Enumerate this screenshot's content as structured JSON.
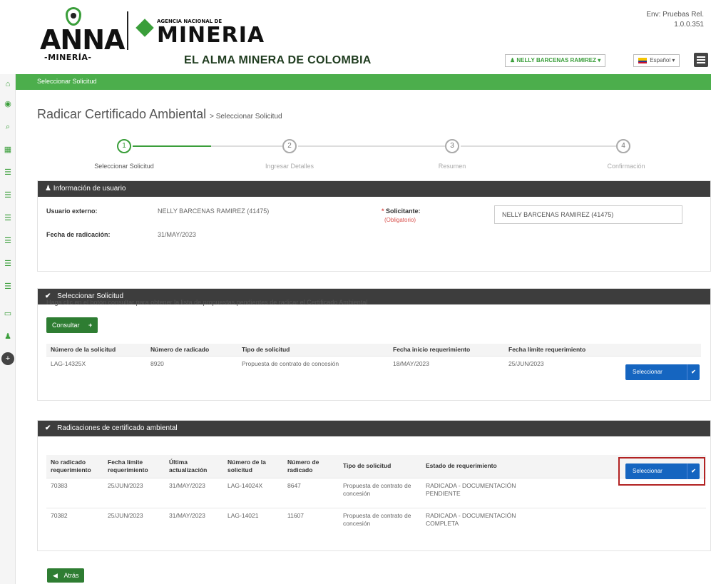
{
  "header": {
    "logo_word": "ANNA",
    "logo_sub": "-MINERÍA-",
    "agency_small": "AGENCIA NACIONAL DE",
    "agency_big": "MINERIA",
    "tagline": "EL ALMA MINERA DE COLOMBIA",
    "env_line1": "Env: Pruebas Rel.",
    "env_line2": "1.0.0.351",
    "user_label": "NELLY BARCENAS RAMIREZ",
    "lang_label": "Español"
  },
  "sidebar": {
    "icons": [
      "home-icon",
      "map-marker-icon",
      "search-icon",
      "grid-icon",
      "list-icon",
      "list-icon",
      "list-icon",
      "list-icon",
      "list-icon",
      "list-icon",
      "folder-icon",
      "user-icon",
      "plus-circle-icon"
    ]
  },
  "breadcrumb": "Seleccionar Solicitud",
  "page": {
    "title": "Radicar Certificado Ambiental",
    "subtitle": "> Seleccionar Solicitud"
  },
  "stepper": [
    {
      "num": "1",
      "label": "Seleccionar Solicitud"
    },
    {
      "num": "2",
      "label": "Ingresar Detalles"
    },
    {
      "num": "3",
      "label": "Resumen"
    },
    {
      "num": "4",
      "label": "Confirmación"
    }
  ],
  "user_info": {
    "heading": "Información de usuario",
    "usuario_label": "Usuario externo:",
    "usuario_value": "NELLY BARCENAS RAMIREZ (41475)",
    "fecha_label": "Fecha de radicación:",
    "fecha_value": "31/MAY/2023",
    "solicitante_label": "Solicitante:",
    "obligatorio": "(Obligatorio)",
    "solicitante_value": "NELLY BARCENAS RAMIREZ (41475)"
  },
  "select_request": {
    "heading": "Seleccionar Solicitud",
    "instructions": "Haga clic en el botón consultar para obtener la lista de propuestas pendientes de radicar el Certificado Ambiental",
    "consultar_label": "Consultar",
    "columns": [
      "Número de la solicitud",
      "Número de radicado",
      "Tipo de solicitud",
      "Fecha inicio requerimiento",
      "Fecha límite requerimiento"
    ],
    "rows": [
      [
        "LAG-14325X",
        "8920",
        "Propuesta de contrato de concesión",
        "18/MAY/2023",
        "25/JUN/2023"
      ]
    ],
    "select_label": "Seleccionar"
  },
  "radicaciones": {
    "heading": "Radicaciones de certificado ambiental",
    "columns": [
      "No radicado requerimiento",
      "Fecha límite requerimiento",
      "Última actualización",
      "Número de la solicitud",
      "Número de radicado",
      "Tipo de solicitud",
      "Estado de requerimiento"
    ],
    "rows": [
      [
        "70383",
        "25/JUN/2023",
        "31/MAY/2023",
        "LAG-14024X",
        "8647",
        "Propuesta de contrato de concesión",
        "RADICADA - DOCUMENTACIÓN PENDIENTE"
      ],
      [
        "70382",
        "25/JUN/2023",
        "31/MAY/2023",
        "LAG-14021",
        "11607",
        "Propuesta de contrato de concesión",
        "RADICADA - DOCUMENTACIÓN COMPLETA"
      ]
    ],
    "select_label": "Seleccionar"
  },
  "back_label": "Atrás"
}
